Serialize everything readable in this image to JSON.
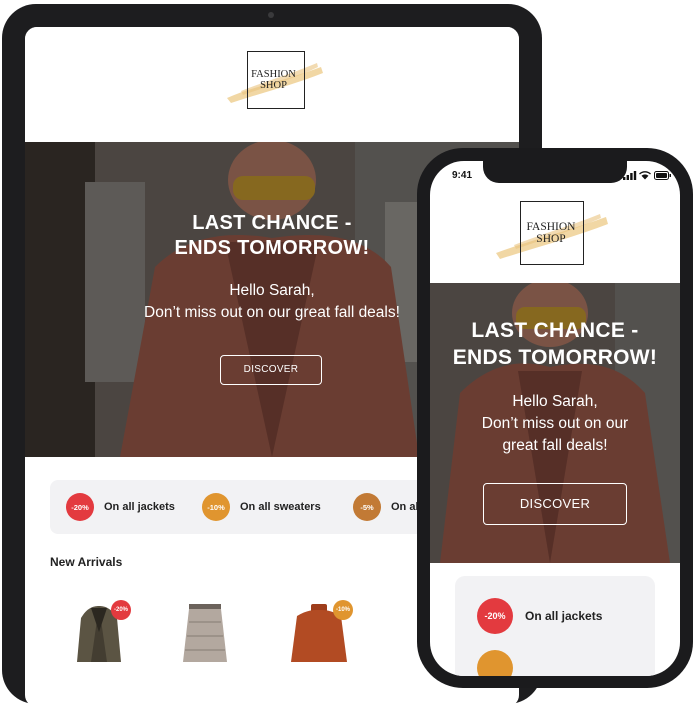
{
  "brand": {
    "line1": "FASHION",
    "line2": "SHOP"
  },
  "status_bar": {
    "time": "9:41"
  },
  "hero": {
    "headline_line1": "LAST CHANCE -",
    "headline_line2": "ENDS TOMORROW!",
    "greeting": "Hello Sarah,",
    "body_tablet": "Don’t miss out on our great fall deals!",
    "body_phone_line1": "Don’t miss out on our",
    "body_phone_line2": "great fall deals!",
    "cta_label": "DISCOVER"
  },
  "promos": [
    {
      "badge": "-20%",
      "label": "On all jackets",
      "color": "#e33a3f"
    },
    {
      "badge": "-10%",
      "label": "On all sweaters",
      "color": "#e0952f"
    },
    {
      "badge": "-5%",
      "label": "On all",
      "color": "#c27a35"
    }
  ],
  "section": {
    "new_arrivals": "New Arrivals"
  },
  "products": [
    {
      "name": "jacket",
      "badge": "-20%",
      "badge_color": "#e33a3f"
    },
    {
      "name": "skirt"
    },
    {
      "name": "sweater",
      "badge": "-10%",
      "badge_color": "#e0952f"
    }
  ],
  "colors": {
    "device_frame": "#1d1d1f",
    "promo_bg": "#f2f2f4",
    "brush_stroke": "#f0d39a"
  }
}
